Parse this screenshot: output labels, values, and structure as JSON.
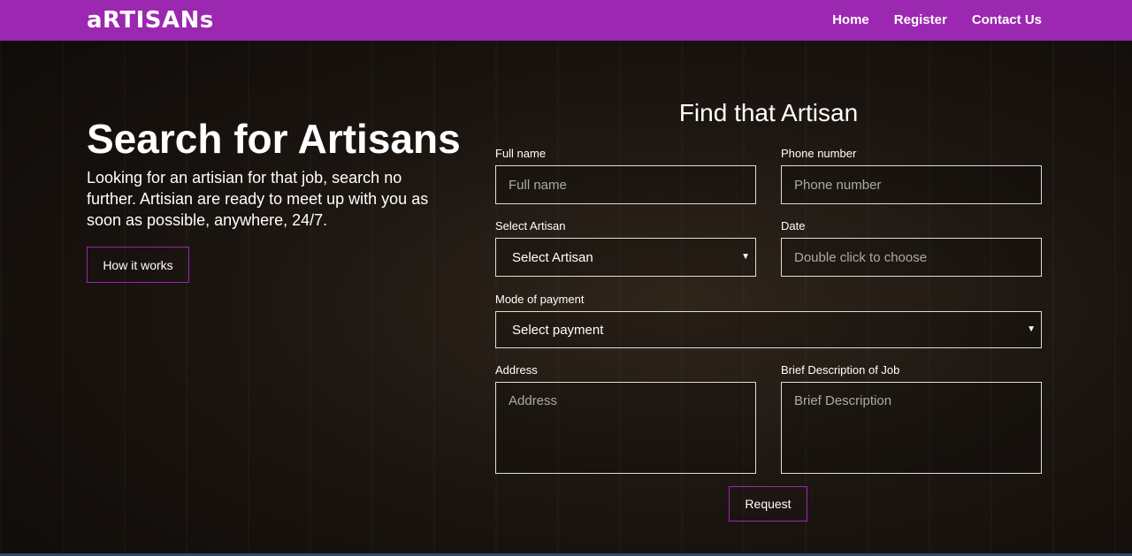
{
  "brand": "aRTISANs",
  "nav": {
    "home": "Home",
    "register": "Register",
    "contact": "Contact Us"
  },
  "hero": {
    "title": "Search for Artisans",
    "text": "Looking for an artisian for that job, search no further. Artisian are ready to meet up with you as soon as possible, anywhere, 24/7.",
    "button": "How it works"
  },
  "form": {
    "title": "Find that Artisan",
    "full_name": {
      "label": "Full name",
      "placeholder": "Full name"
    },
    "phone": {
      "label": "Phone number",
      "placeholder": "Phone number"
    },
    "artisan": {
      "label": "Select Artisan",
      "value": "Select Artisan"
    },
    "date": {
      "label": "Date",
      "placeholder": "Double click to choose"
    },
    "payment": {
      "label": "Mode of payment",
      "value": "Select payment"
    },
    "address": {
      "label": "Address",
      "placeholder": "Address"
    },
    "description": {
      "label": "Brief Description of Job",
      "placeholder": "Brief Description"
    },
    "submit": "Request"
  },
  "colors": {
    "accent": "#9c27b0"
  },
  "icons": {
    "select_caret": "caret-down-icon"
  }
}
